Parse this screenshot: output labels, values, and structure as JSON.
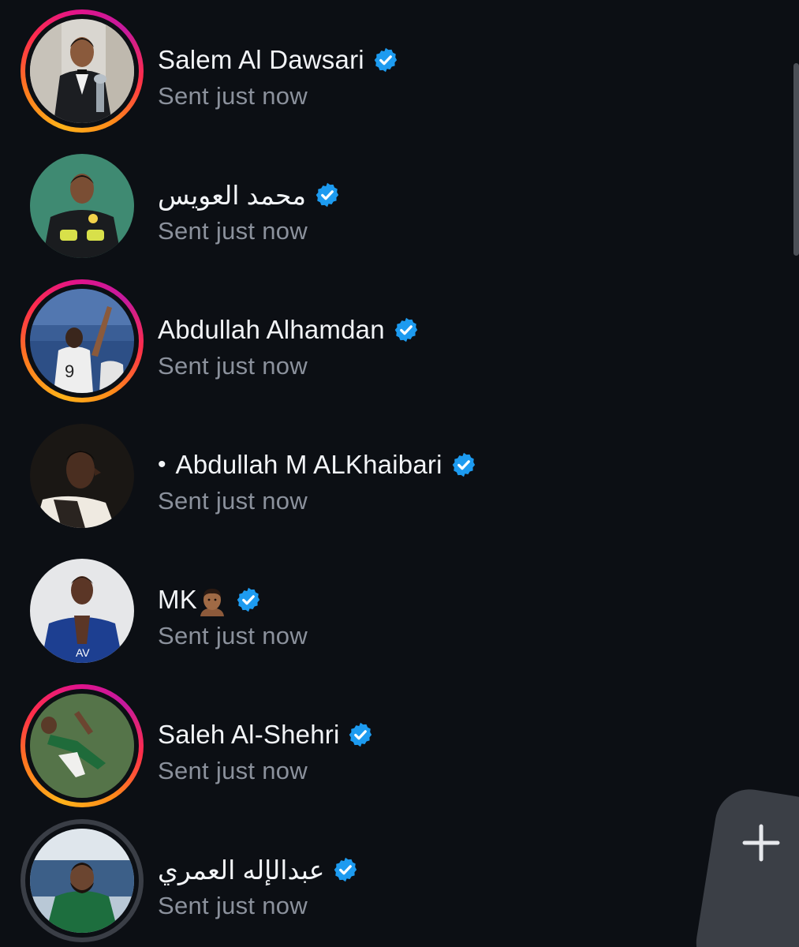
{
  "threads": [
    {
      "name": "Salem Al Dawsari",
      "status": "Sent just now",
      "ring": "story"
    },
    {
      "name": "محمد العويس",
      "status": "Sent just now",
      "ring": "none"
    },
    {
      "name": "Abdullah Alhamdan",
      "status": "Sent just now",
      "ring": "story"
    },
    {
      "name": "Abdullah M ALKhaibari",
      "prefix": "•",
      "status": "Sent just now",
      "ring": "none"
    },
    {
      "name": "MK",
      "emoji": "man-medium-dark-skin",
      "status": "Sent just now",
      "ring": "none"
    },
    {
      "name": "Saleh Al-Shehri",
      "status": "Sent just now",
      "ring": "story"
    },
    {
      "name": "عبدالإله العمري",
      "status": "Sent just now",
      "ring": "seen"
    }
  ],
  "icons": {
    "verified": "verified-badge-icon",
    "new_message": "plus-icon"
  },
  "colors": {
    "background": "#0c0f14",
    "name_text": "#f2f4f7",
    "status_text": "#8b919c",
    "verified_blue": "#1d9bf0",
    "story_ring": [
      "#ffb21a",
      "#ff2d4a",
      "#c51a9e"
    ],
    "seen_ring": "#3a3e46"
  }
}
